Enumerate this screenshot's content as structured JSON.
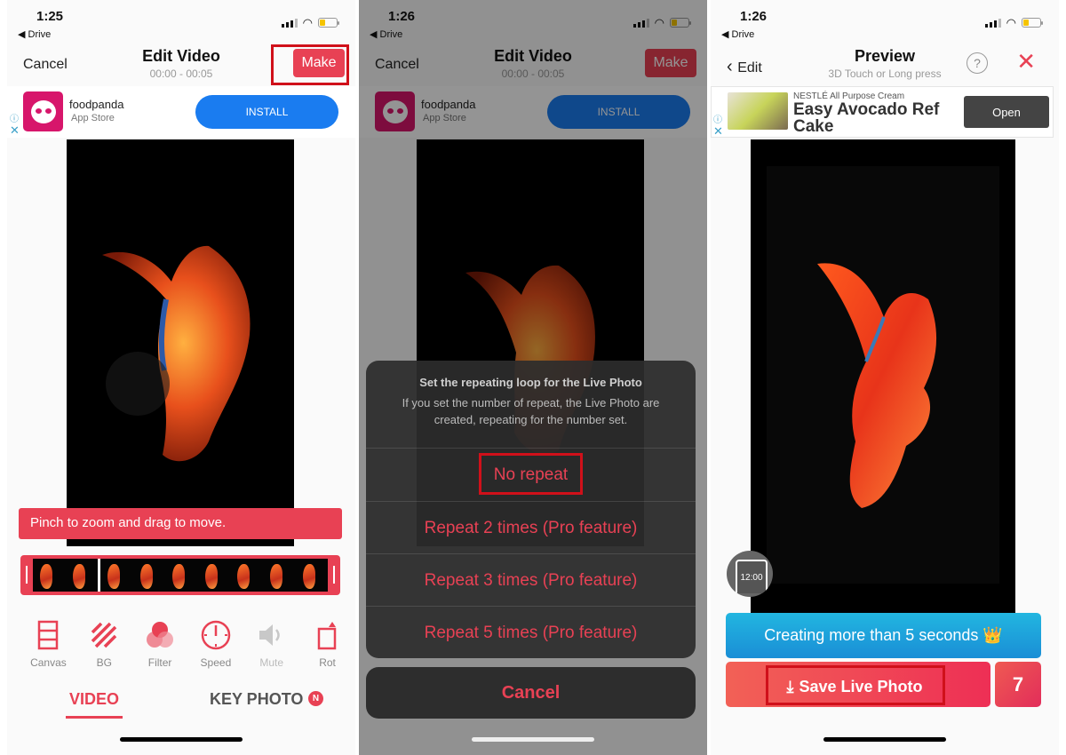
{
  "colors": {
    "accent": "#e84154",
    "install_blue": "#1a7cf0",
    "highlight_red": "#d0101a",
    "premium_blue": "#1a8ed6"
  },
  "panel1": {
    "status": {
      "time": "1:25",
      "back_app": "◀ Drive"
    },
    "nav": {
      "cancel": "Cancel",
      "title": "Edit Video",
      "subtitle": "00:00 - 00:05",
      "make": "Make"
    },
    "ad": {
      "name": "foodpanda",
      "store": "App Store",
      "install": "INSTALL",
      "info_icon": "ⓘ",
      "close_icon": "✕"
    },
    "toast": "Pinch to zoom and drag to move.",
    "tools": [
      {
        "label": "Canvas",
        "icon": "canvas-icon",
        "enabled": true
      },
      {
        "label": "BG",
        "icon": "background-stripes-icon",
        "enabled": true
      },
      {
        "label": "Filter",
        "icon": "filter-circles-icon",
        "enabled": true
      },
      {
        "label": "Speed",
        "icon": "speedometer-icon",
        "enabled": true
      },
      {
        "label": "Mute",
        "icon": "speaker-icon",
        "enabled": false
      },
      {
        "label": "Rot",
        "icon": "rotate-icon",
        "enabled": true
      }
    ],
    "tabs": {
      "video": "VIDEO",
      "key_photo": "KEY PHOTO",
      "new_badge": "N"
    }
  },
  "panel2": {
    "status": {
      "time": "1:26",
      "back_app": "◀ Drive"
    },
    "nav": {
      "cancel": "Cancel",
      "title": "Edit Video",
      "subtitle": "00:00 - 00:05",
      "make": "Make"
    },
    "ad": {
      "name": "foodpanda",
      "store": "App Store",
      "install": "INSTALL"
    },
    "sheet": {
      "title": "Set the repeating loop for the Live Photo",
      "message": "If you set the number of repeat, the Live Photo are created, repeating for the number set.",
      "options": [
        "No repeat",
        "Repeat 2 times (Pro feature)",
        "Repeat 3 times (Pro feature)",
        "Repeat 5 times (Pro feature)"
      ],
      "cancel": "Cancel"
    }
  },
  "panel3": {
    "status": {
      "time": "1:26",
      "back_app": "◀ Drive"
    },
    "nav": {
      "back": "Edit",
      "title": "Preview",
      "subtitle": "3D Touch or Long press",
      "help": "?",
      "close": "✕"
    },
    "ad": {
      "brand": "NESTLÉ All Purpose Cream",
      "title": "Easy Avocado Ref Cake",
      "open": "Open"
    },
    "clock_badge": "12:00",
    "premium_button": "Creating more than 5 seconds 👑",
    "save_button": "Save Live Photo",
    "share_icon": "7"
  }
}
